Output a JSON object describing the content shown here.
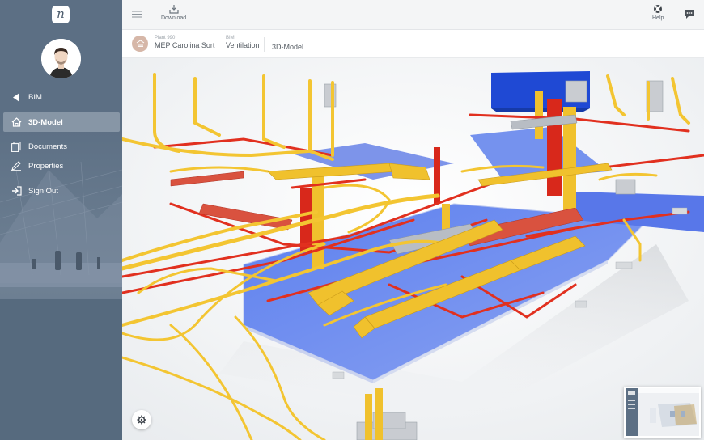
{
  "sidebar": {
    "logo_letter": "n",
    "items": [
      {
        "label": "BIM",
        "icon": "back-triangle-icon"
      },
      {
        "label": "3D-Model",
        "icon": "home-icon",
        "active": true
      },
      {
        "label": "Documents",
        "icon": "documents-icon"
      },
      {
        "label": "Properties",
        "icon": "pencil-icon"
      },
      {
        "label": "Sign Out",
        "icon": "sign-out-icon"
      }
    ]
  },
  "toolbar": {
    "download_label": "Download",
    "help_label": "Help"
  },
  "breadcrumb": {
    "project_sup": "Plant 990",
    "project": "MEP Carolina Sort",
    "model_sup": "BIM",
    "model": "Ventilation",
    "view": "3D-Model"
  },
  "colors": {
    "sidebar": "#5c6f84",
    "active_item": "#8796a6",
    "duct_yellow": "#f1c232",
    "pipe_red": "#e0301e",
    "floor_blue": "#6f8ff0"
  }
}
